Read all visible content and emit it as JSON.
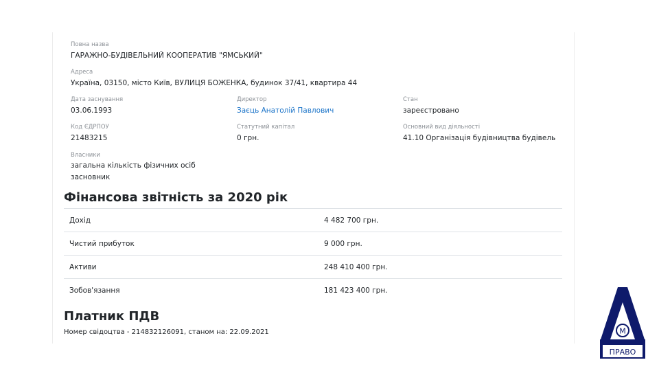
{
  "company": {
    "full_name_label": "Повна назва",
    "full_name": "ГАРАЖНО-БУДІВЕЛЬНИЙ КООПЕРАТИВ \"ЯМСЬКИЙ\"",
    "address_label": "Адреса",
    "address": "Україна, 03150, місто Київ, ВУЛИЦЯ БОЖЕНКА, будинок 37/41, квартира 44",
    "founded_label": "Дата заснування",
    "founded": "03.06.1993",
    "director_label": "Директор",
    "director": "Заєць Анатолій Павлович",
    "status_label": "Стан",
    "status": "зареєстровано",
    "edrpou_label": "Код ЄДРПОУ",
    "edrpou": "21483215",
    "capital_label": "Статутний капітал",
    "capital": "0 грн.",
    "activity_label": "Основний вид діяльності",
    "activity": "41.10 Організація будівництва будівель",
    "owners_label": "Власники",
    "owners": [
      "загальна кількість фізичних осіб",
      "засновник"
    ]
  },
  "financials": {
    "heading": "Фінансова звітність за 2020 рік",
    "rows": [
      {
        "name": "Дохід",
        "value": "4 482 700 грн."
      },
      {
        "name": "Чистий прибуток",
        "value": "9 000 грн."
      },
      {
        "name": "Активи",
        "value": "248 410 400 грн."
      },
      {
        "name": "Зобов'язання",
        "value": "181 423 400 грн."
      }
    ]
  },
  "vat": {
    "heading": "Платник ПДВ",
    "certificate_text": "Номер свідоцтва - 214832126091, станом на: 22.09.2021"
  },
  "logo": {
    "letter_m": "М",
    "caption": "ПРАВО",
    "color": "#0e1a6b"
  }
}
